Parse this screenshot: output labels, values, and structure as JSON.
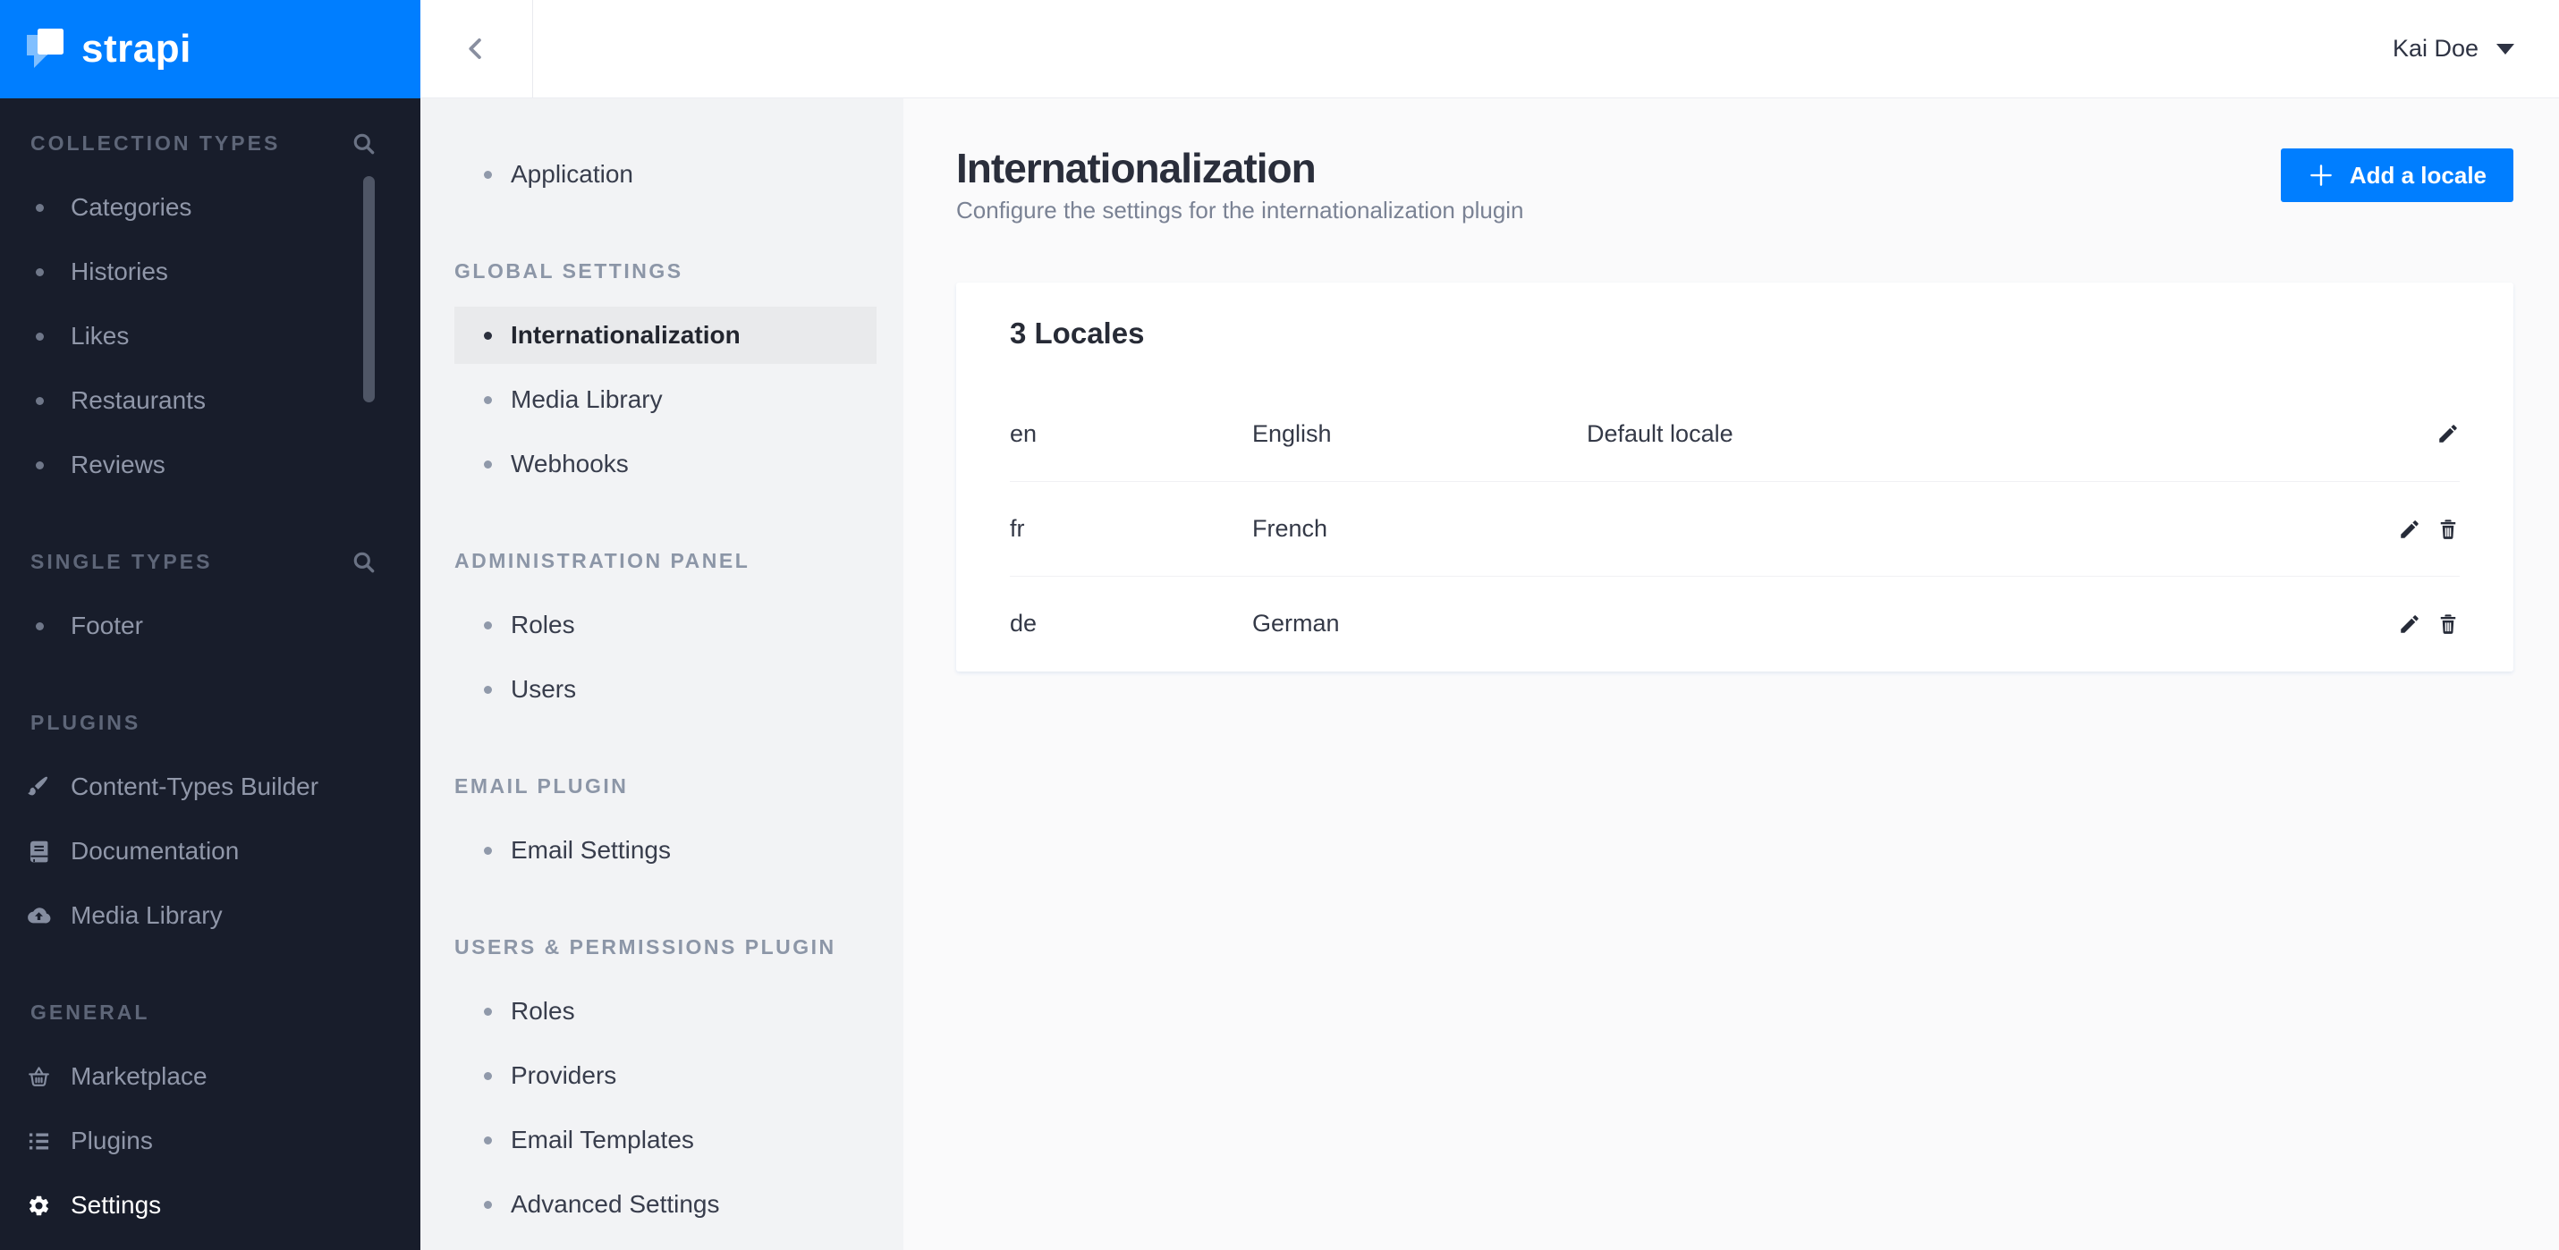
{
  "brand": {
    "name": "strapi",
    "accent_color": "#007EFF",
    "sidebar_color": "#181D2B"
  },
  "sidebar": {
    "sections": [
      {
        "label": "COLLECTION TYPES",
        "search_icon": "search-icon",
        "items": [
          {
            "label": "Categories"
          },
          {
            "label": "Histories"
          },
          {
            "label": "Likes"
          },
          {
            "label": "Restaurants"
          },
          {
            "label": "Reviews"
          }
        ]
      },
      {
        "label": "SINGLE TYPES",
        "search_icon": "search-icon",
        "items": [
          {
            "label": "Footer"
          }
        ]
      },
      {
        "label": "PLUGINS",
        "items": [
          {
            "label": "Content-Types Builder",
            "icon": "brush-icon"
          },
          {
            "label": "Documentation",
            "icon": "book-icon"
          },
          {
            "label": "Media Library",
            "icon": "cloud-upload-icon"
          }
        ]
      },
      {
        "label": "GENERAL",
        "items": [
          {
            "label": "Marketplace",
            "icon": "basket-icon"
          },
          {
            "label": "Plugins",
            "icon": "list-icon"
          },
          {
            "label": "Settings",
            "icon": "gear-icon",
            "active": true
          }
        ]
      }
    ]
  },
  "header": {
    "back_icon": "chevron-left-icon",
    "user": "Kai Doe",
    "caret_icon": "caret-down-icon"
  },
  "settings_menu": {
    "sections": [
      {
        "label": "",
        "items": [
          {
            "label": "Application"
          }
        ]
      },
      {
        "label": "GLOBAL SETTINGS",
        "items": [
          {
            "label": "Internationalization",
            "active": true
          },
          {
            "label": "Media Library"
          },
          {
            "label": "Webhooks"
          }
        ]
      },
      {
        "label": "ADMINISTRATION PANEL",
        "items": [
          {
            "label": "Roles"
          },
          {
            "label": "Users"
          }
        ]
      },
      {
        "label": "EMAIL PLUGIN",
        "items": [
          {
            "label": "Email Settings"
          }
        ]
      },
      {
        "label": "USERS & PERMISSIONS PLUGIN",
        "items": [
          {
            "label": "Roles"
          },
          {
            "label": "Providers"
          },
          {
            "label": "Email Templates"
          },
          {
            "label": "Advanced Settings"
          }
        ]
      }
    ]
  },
  "page": {
    "title": "Internationalization",
    "subtitle": "Configure the settings for the internationalization plugin",
    "add_button_label": "Add a locale",
    "card": {
      "title": "3 Locales",
      "rows": [
        {
          "code": "en",
          "name": "English",
          "note": "Default locale",
          "actions": [
            "edit"
          ]
        },
        {
          "code": "fr",
          "name": "French",
          "note": "",
          "actions": [
            "edit",
            "delete"
          ]
        },
        {
          "code": "de",
          "name": "German",
          "note": "",
          "actions": [
            "edit",
            "delete"
          ]
        }
      ]
    }
  }
}
